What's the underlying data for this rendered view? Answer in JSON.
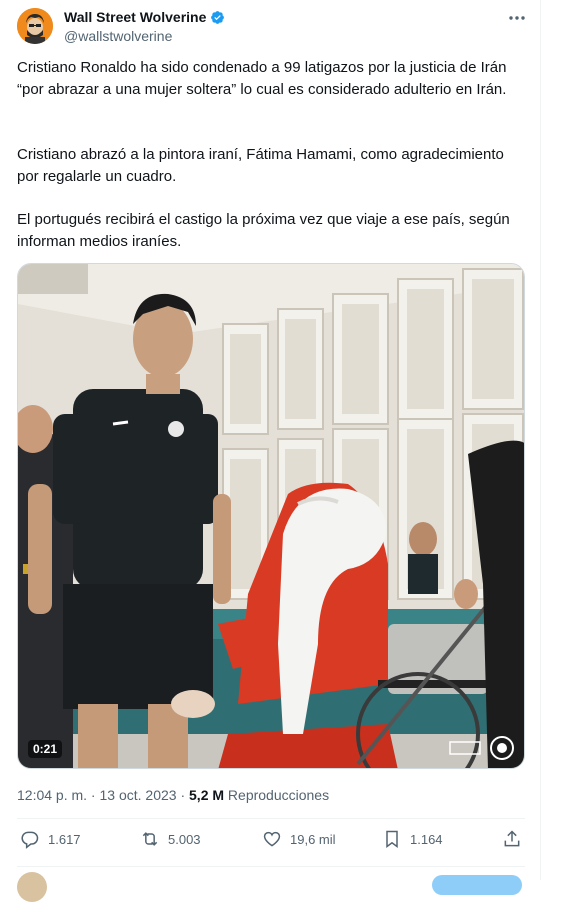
{
  "tweet": {
    "author_name": "Wall Street Wolverine",
    "author_handle": "@wallstwolverine",
    "paragraphs": [
      "Cristiano Ronaldo ha sido condenado a 99 latigazos por la justicia de Irán “por abrazar a una mujer soltera” lo cual es considerado adulterio en Irán.",
      "Cristiano abrazó a la pintora iraní, Fátima Hamami, como agradecimiento por regalarle un cuadro.",
      "El portugués recibirá el castigo la próxima vez que viaje a ese país, según informan medios iraníes."
    ],
    "video_duration": "0:21",
    "time": "12:04 p. m.",
    "date": "13 oct. 2023",
    "views_count": "5,2 M",
    "views_label": "Reproducciones",
    "stats": {
      "replies": "1.617",
      "reposts": "5.003",
      "likes": "19,6 mil",
      "bookmarks": "1.164"
    }
  },
  "icons": [
    "verified-icon",
    "more-icon",
    "reply-icon",
    "repost-icon",
    "like-icon",
    "bookmark-icon",
    "share-icon"
  ],
  "colors": {
    "accent": "#1d9bf0",
    "secondary_text": "#536471",
    "divider": "#eff3f4"
  }
}
